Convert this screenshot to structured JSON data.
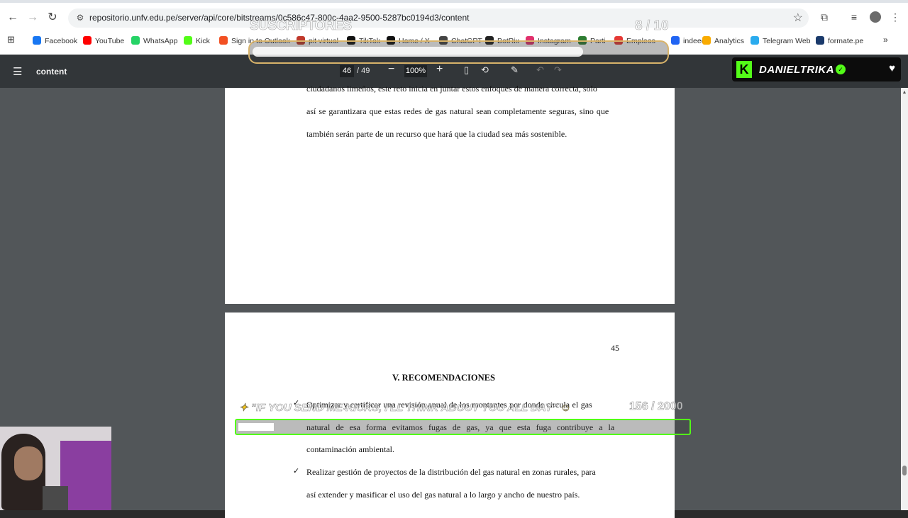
{
  "browser": {
    "url": "repositorio.unfv.edu.pe/server/api/core/bitstreams/0c586c47-800c-4aa2-9500-5287bc0194d3/content",
    "bookmarks": [
      {
        "label": "Facebook",
        "color": "#1877f2"
      },
      {
        "label": "YouTube",
        "color": "#ff0000"
      },
      {
        "label": "WhatsApp",
        "color": "#25d366"
      },
      {
        "label": "Kick",
        "color": "#53fc18"
      },
      {
        "label": "Sign in to Outlook",
        "color": "#f25022"
      },
      {
        "label": "pit virtual",
        "color": "#c0392b"
      },
      {
        "label": "TikTok",
        "color": "#111111"
      },
      {
        "label": "Home / X",
        "color": "#111111"
      },
      {
        "label": "ChatGPT",
        "color": "#444444"
      },
      {
        "label": "BotRix",
        "color": "#222222"
      },
      {
        "label": "Instagram",
        "color": "#e1306c"
      },
      {
        "label": "Parti",
        "color": "#2e7d32"
      },
      {
        "label": "Empleos",
        "color": "#e53935"
      },
      {
        "label": "indeed",
        "color": "#2164f3"
      },
      {
        "label": "Analytics",
        "color": "#f9ab00"
      },
      {
        "label": "Telegram Web",
        "color": "#2aabee"
      },
      {
        "label": "formate.pe",
        "color": "#1a3a6b"
      }
    ]
  },
  "pdf_toolbar": {
    "title": "content",
    "page_current": "46",
    "page_total": "/ 49",
    "zoom": "100%"
  },
  "overlay": {
    "subscribers_label": "SUSCRIPTORES",
    "subscribers_count": "8 / 10",
    "subscribers_progress": 0.8,
    "streamer_name": "DANIELTRIKA",
    "kicks_label": "\"IF YOU SEND ME KICKS, I'LL THINK ABOUT YOU ALL DAY\"",
    "kicks_count": "156 / 2000",
    "kicks_progress": 0.078,
    "accent_color": "#53fc18",
    "subs_border_color": "#d8b36a"
  },
  "document": {
    "page_a_lines": [
      "ciudadanos limeños, este reto inicia en juntar estos enfoques de manera correcta, solo",
      "así se garantizara que estas redes de gas natural sean completamente seguras, sino que",
      "también serán parte de un recurso que hará que la ciudad sea más sostenible."
    ],
    "page_b_number": "45",
    "page_b_heading": "V. RECOMENDACIONES",
    "page_b_items": [
      {
        "lines": [
          "Optimizar y certificar una revisión anual de los montantes por donde circula el gas",
          "natural de esa forma evitamos fugas de gas, ya que esta fuga contribuye a la",
          "contaminación ambiental."
        ]
      },
      {
        "lines": [
          "Realizar gestión de proyectos de la distribución del gas natural en zonas rurales, para",
          "así extender y masificar el uso del gas natural a lo largo y ancho de nuestro país."
        ]
      }
    ],
    "check_mark": "✓"
  }
}
